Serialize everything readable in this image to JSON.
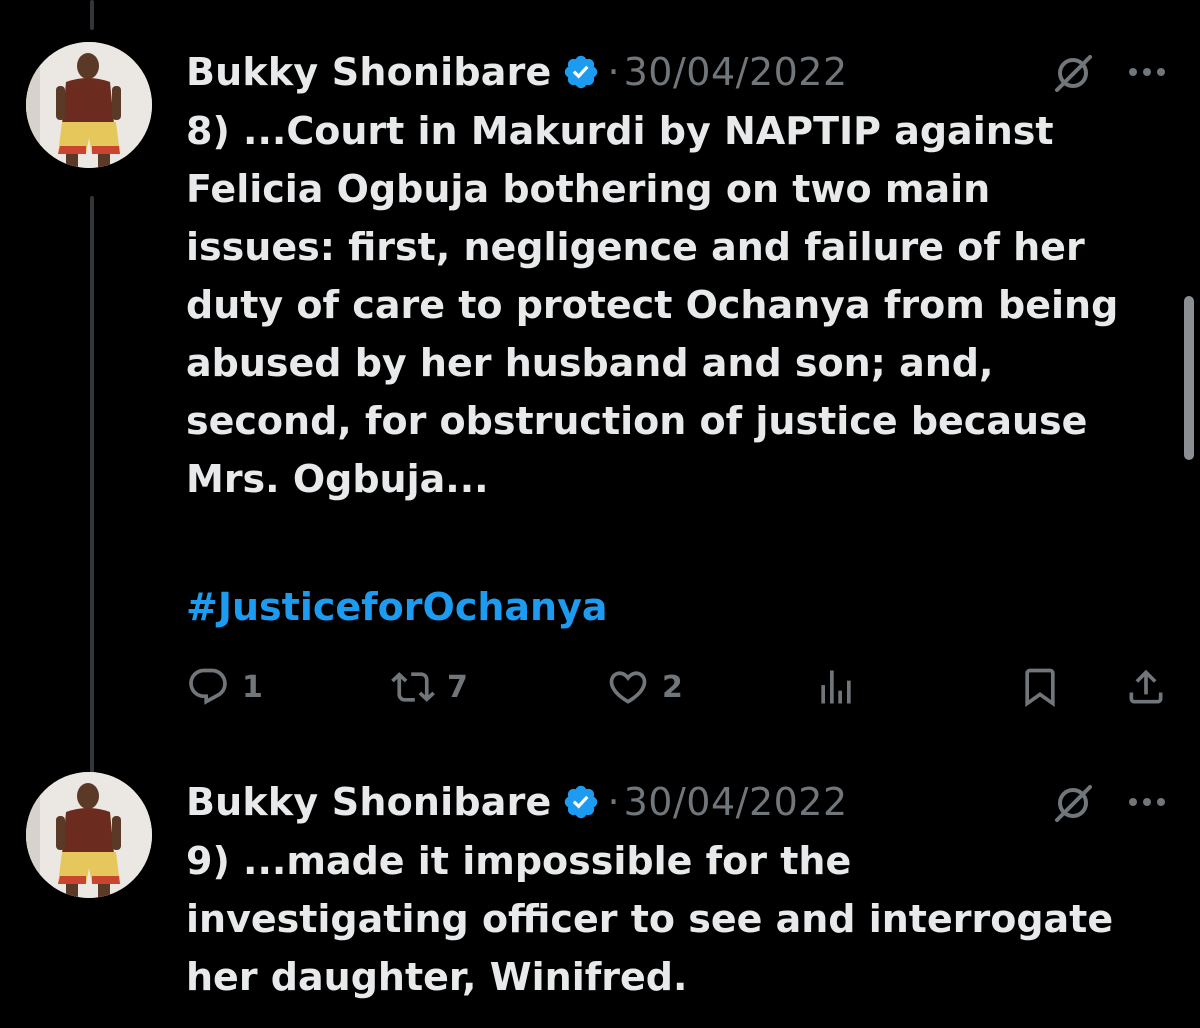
{
  "tweets": [
    {
      "author": "Bukky Shonibare",
      "date": "30/04/2022",
      "text": "8) ...Court in Makurdi by NAPTIP against\nFelicia Ogbuja bothering on two main\nissues: first, negligence and failure of her\nduty of care to protect Ochanya from being\nabused by her husband and son; and,\nsecond, for obstruction of justice because\nMrs. Ogbuja...",
      "hashtag": "#JusticeforOchanya",
      "replies": "1",
      "retweets": "7",
      "likes": "2"
    },
    {
      "author": "Bukky Shonibare",
      "date": "30/04/2022",
      "text": "9) ...made it impossible for the\ninvestigating officer to see and interrogate\nher daughter, Winifred."
    }
  ],
  "icons": {
    "verified": "verified-badge-icon",
    "grok": "grok-icon",
    "more": "more-icon",
    "reply": "reply-icon",
    "retweet": "retweet-icon",
    "like": "like-icon",
    "views": "views-icon",
    "bookmark": "bookmark-icon",
    "share": "share-icon"
  },
  "colors": {
    "background": "#000000",
    "text": "#e7e9ea",
    "muted": "#71767b",
    "link": "#1d9bf0",
    "verified": "#1d9bf0"
  }
}
